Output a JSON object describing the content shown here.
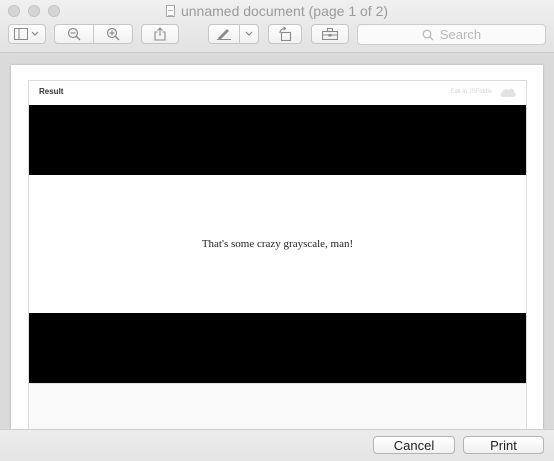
{
  "window": {
    "title": "unnamed document (page 1 of 2)"
  },
  "toolbar": {
    "search_placeholder": "Search",
    "icons": [
      "sidebar-icon",
      "chevron-down-icon",
      "zoom-out-icon",
      "zoom-in-icon",
      "share-icon",
      "markup-pen-icon",
      "chevron-down-icon",
      "rotate-icon",
      "toolbox-icon",
      "search-icon"
    ]
  },
  "document": {
    "result_label": "Result",
    "edit_link": "Edit in JSFiddle",
    "message": "That's some crazy grayscale, man!"
  },
  "footer": {
    "cancel_label": "Cancel",
    "print_label": "Print"
  }
}
